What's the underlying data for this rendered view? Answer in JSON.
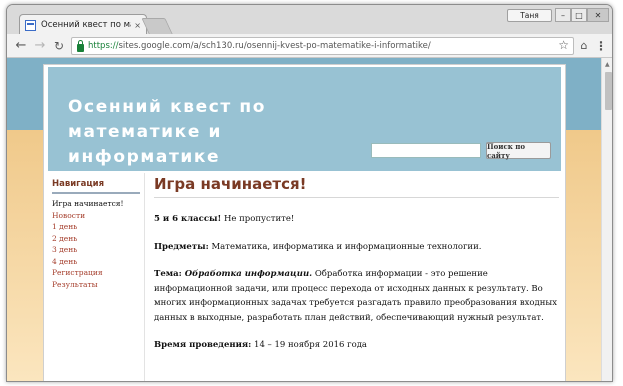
{
  "browser": {
    "tab_title": "Осенний квест по матем",
    "tab_close": "×",
    "user_button": "Таня",
    "url_scheme": "https://",
    "url_rest": "sites.google.com/a/sch130.ru/osennij-kvest-po-matematike-i-informatike/",
    "icons": {
      "back": "back-arrow-icon",
      "forward": "forward-arrow-icon",
      "reload": "reload-icon",
      "star": "star-icon",
      "extension": "extension-icon",
      "menu": "menu-icon"
    }
  },
  "site": {
    "title": "Осенний квест по математике и информатике",
    "search_button": "Поиск по сайту",
    "search_value": ""
  },
  "sidebar": {
    "heading": "Навигация",
    "items": [
      {
        "label": "Игра начинается!",
        "current": true
      },
      {
        "label": "Новости"
      },
      {
        "label": "1 день"
      },
      {
        "label": "2 день"
      },
      {
        "label": "3 день"
      },
      {
        "label": "4 день"
      },
      {
        "label": "Регистрация"
      },
      {
        "label": "Результаты"
      }
    ]
  },
  "content": {
    "page_title": "Игра начинается!",
    "p1_label": "5 и 6 классы!",
    "p1_text": " Не пропустите!",
    "p2_label": "Предметы:",
    "p2_text": " Математика, информатика и информационные технологии.",
    "p3_label": "Тема:",
    "p3_topic": " Обработка  информации.",
    "p3_text": " Обработка информации - это решение информационной задачи, или процесс перехода от исходных данных к результату. Во многих информационных задачах требуется разгадать правило преобразования входных данных в выходные, разработать план действий, обеспечивающий нужный результат.",
    "p4_label": "Время проведения:",
    "p4_text": " 14 – 19 ноября 2016 года"
  },
  "colors": {
    "header_bg": "#98c2d3",
    "title_text": "#ffffff",
    "heading_brown": "#7a3a24",
    "link_red": "#a53e2c",
    "sky_blue": "#7fb0c6",
    "sand": "#f0c98a"
  }
}
